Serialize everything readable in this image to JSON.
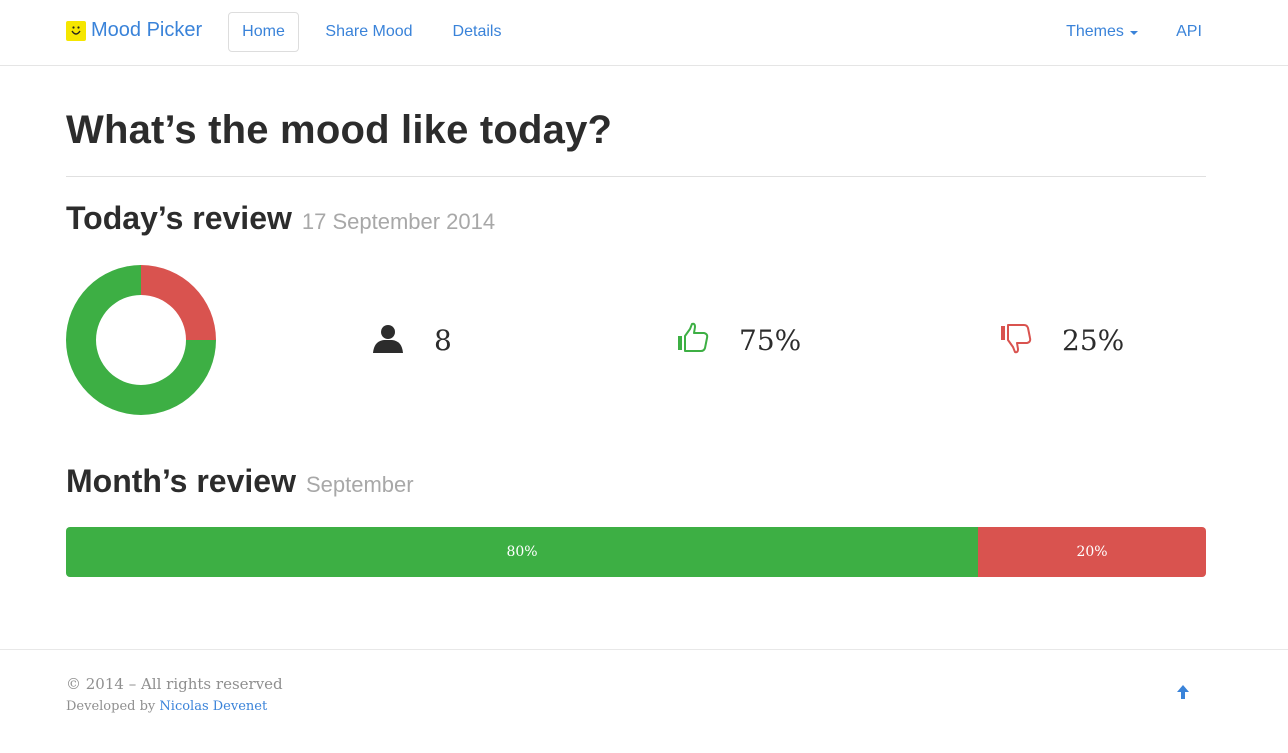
{
  "nav": {
    "brand": "Mood Picker",
    "brand_icon": "smiley-icon",
    "links": [
      {
        "label": "Home",
        "active": true
      },
      {
        "label": "Share Mood",
        "active": false
      },
      {
        "label": "Details",
        "active": false
      }
    ],
    "themes_label": "Themes",
    "api_label": "API"
  },
  "main": {
    "title": "What’s the mood like today?",
    "today": {
      "heading": "Today’s review",
      "date": "17 September 2014",
      "users_count": "8",
      "positive_pct": "75%",
      "negative_pct": "25%",
      "icons": {
        "users": "user-icon",
        "positive": "thumbs-up-icon",
        "negative": "thumbs-down-icon"
      }
    },
    "month": {
      "heading": "Month’s review",
      "month": "September",
      "positive_label": "80%",
      "negative_label": "20%"
    }
  },
  "chart_data": [
    {
      "type": "pie",
      "categories": [
        "positive",
        "negative"
      ],
      "values": [
        75,
        25
      ],
      "colors": [
        "#3daf44",
        "#d9534f"
      ]
    },
    {
      "type": "bar",
      "categories": [
        "positive",
        "negative"
      ],
      "values": [
        80,
        20
      ],
      "colors": [
        "#3daf44",
        "#d9534f"
      ]
    }
  ],
  "footer": {
    "copyright": "© 2014 – All rights reserved",
    "developed_prefix": "Developed by ",
    "developer": "Nicolas Devenet",
    "back_to_top_icon": "arrow-up-icon"
  },
  "colors": {
    "accent": "#3a83d9",
    "positive": "#3daf44",
    "negative": "#d9534f",
    "brand_icon_bg": "#f5e600"
  }
}
